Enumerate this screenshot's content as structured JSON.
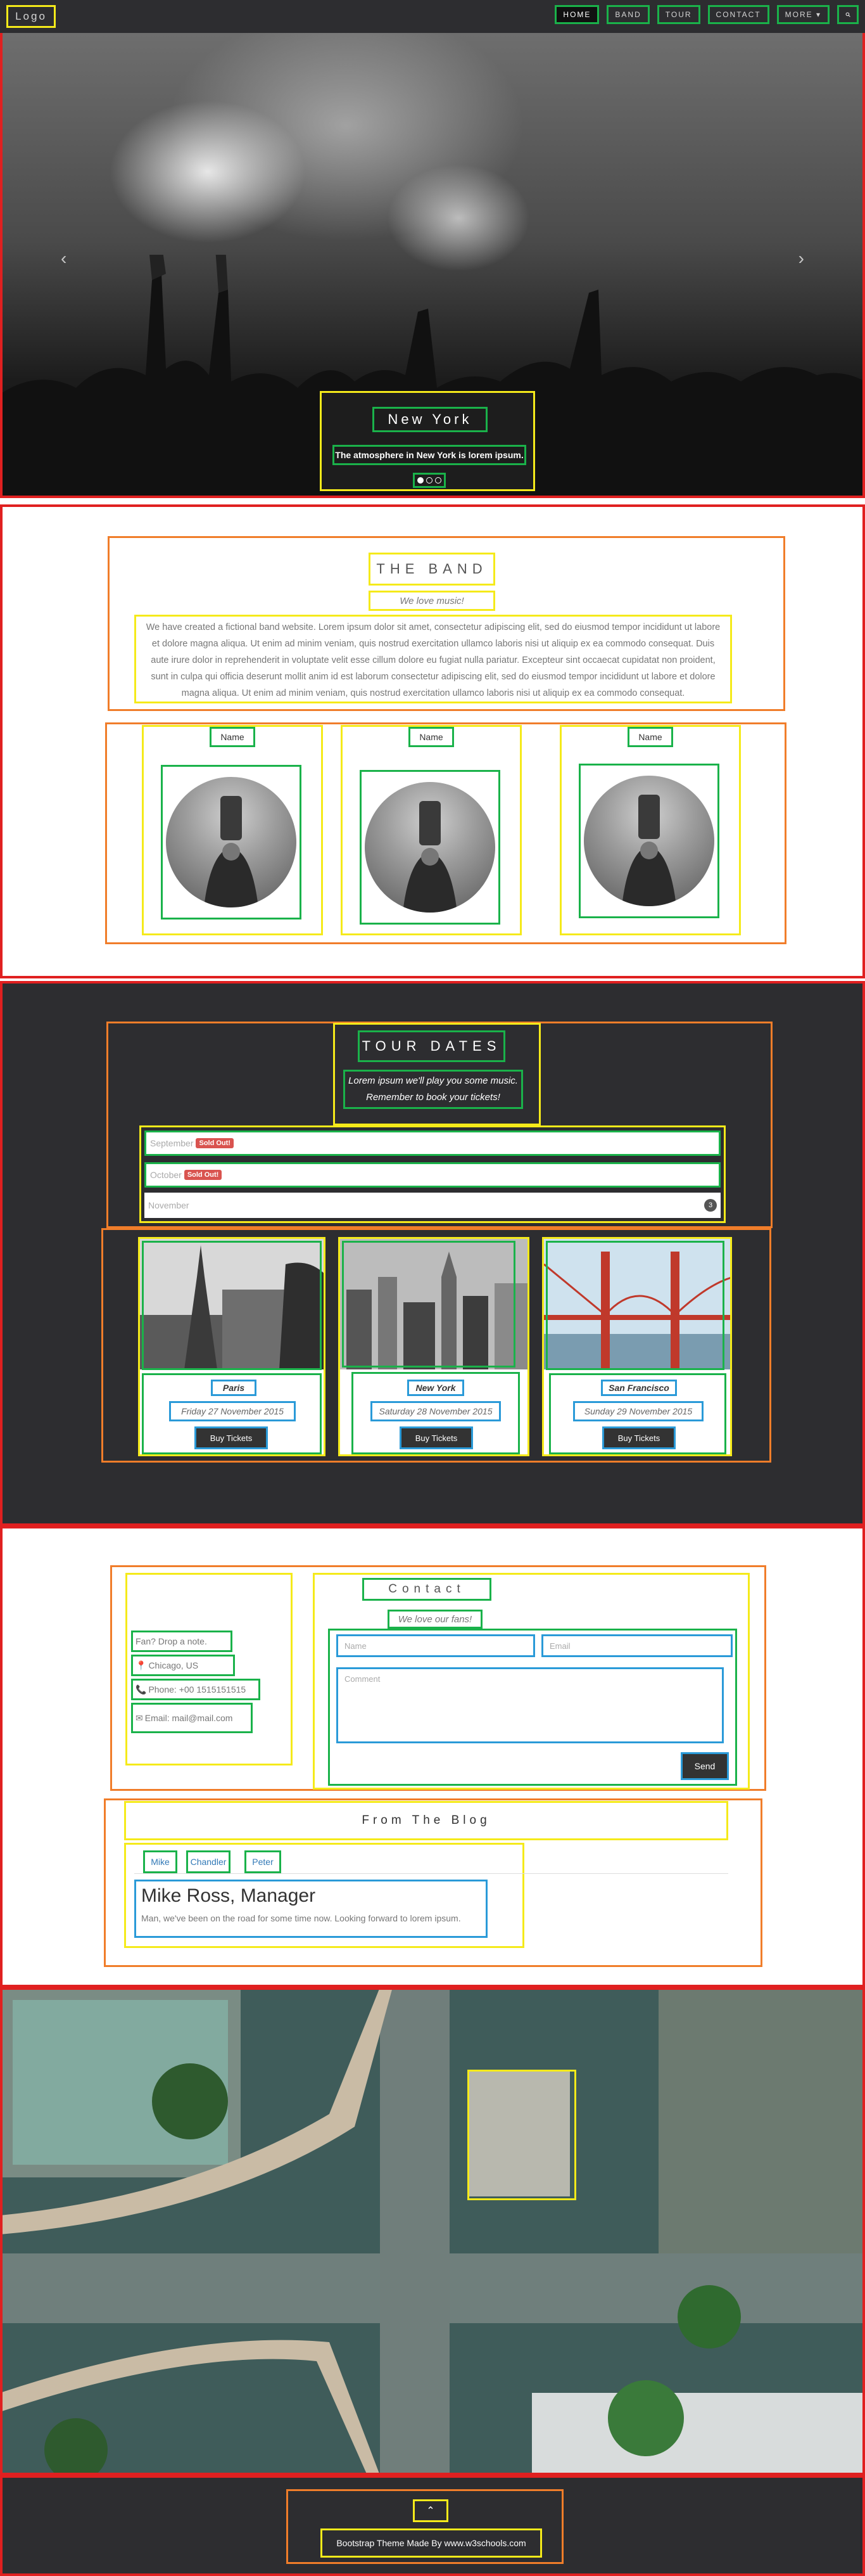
{
  "nav": {
    "logo": "Logo",
    "items": [
      "HOME",
      "BAND",
      "TOUR",
      "CONTACT",
      "MORE ▾"
    ],
    "search_icon": "search-icon"
  },
  "hero": {
    "title": "New York",
    "text": "The atmosphere in New York is lorem ipsum.",
    "slides": 3,
    "active_slide": 1
  },
  "band": {
    "title": "THE BAND",
    "subtitle": "We love music!",
    "paragraph": "We have created a fictional band website. Lorem ipsum dolor sit amet, consectetur adipiscing elit, sed do eiusmod tempor incididunt ut labore et dolore magna aliqua. Ut enim ad minim veniam, quis nostrud exercitation ullamco laboris nisi ut aliquip ex ea commodo consequat. Duis aute irure dolor in reprehenderit in voluptate velit esse cillum dolore eu fugiat nulla pariatur. Excepteur sint occaecat cupidatat non proident, sunt in culpa qui officia deserunt mollit anim id est laborum consectetur adipiscing elit, sed do eiusmod tempor incididunt ut labore et dolore magna aliqua. Ut enim ad minim veniam, quis nostrud exercitation ullamco laboris nisi ut aliquip ex ea commodo consequat.",
    "members": [
      {
        "name": "Name"
      },
      {
        "name": "Name"
      },
      {
        "name": "Name"
      }
    ]
  },
  "tour": {
    "title": "TOUR DATES",
    "subtitle_line1": "Lorem ipsum we'll play you some music.",
    "subtitle_line2": "Remember to book your tickets!",
    "months": [
      {
        "name": "September",
        "badge": "Sold Out!"
      },
      {
        "name": "October",
        "badge": "Sold Out!"
      },
      {
        "name": "November",
        "count": "3"
      }
    ],
    "cities": [
      {
        "name": "Paris",
        "date": "Friday 27 November 2015",
        "button": "Buy Tickets"
      },
      {
        "name": "New York",
        "date": "Saturday 28 November 2015",
        "button": "Buy Tickets"
      },
      {
        "name": "San Francisco",
        "date": "Sunday 29 November 2015",
        "button": "Buy Tickets"
      }
    ]
  },
  "contact": {
    "title": "Contact",
    "subtitle": "We love our fans!",
    "note": "Fan? Drop a note.",
    "location": "Chicago, US",
    "phone": "Phone: +00 1515151515",
    "email": "Email: mail@mail.com",
    "name_placeholder": "Name",
    "email_placeholder": "Email",
    "comment_placeholder": "Comment",
    "send": "Send"
  },
  "blog": {
    "title": "From The Blog",
    "tabs": [
      "Mike",
      "Chandler",
      "Peter"
    ],
    "post_title": "Mike Ross, Manager",
    "post_text": "Man, we've been on the road for some time now. Looking forward to lorem ipsum."
  },
  "footer": {
    "up_icon": "chevron-up-icon",
    "text": "Bootstrap Theme Made By www.w3schools.com"
  }
}
